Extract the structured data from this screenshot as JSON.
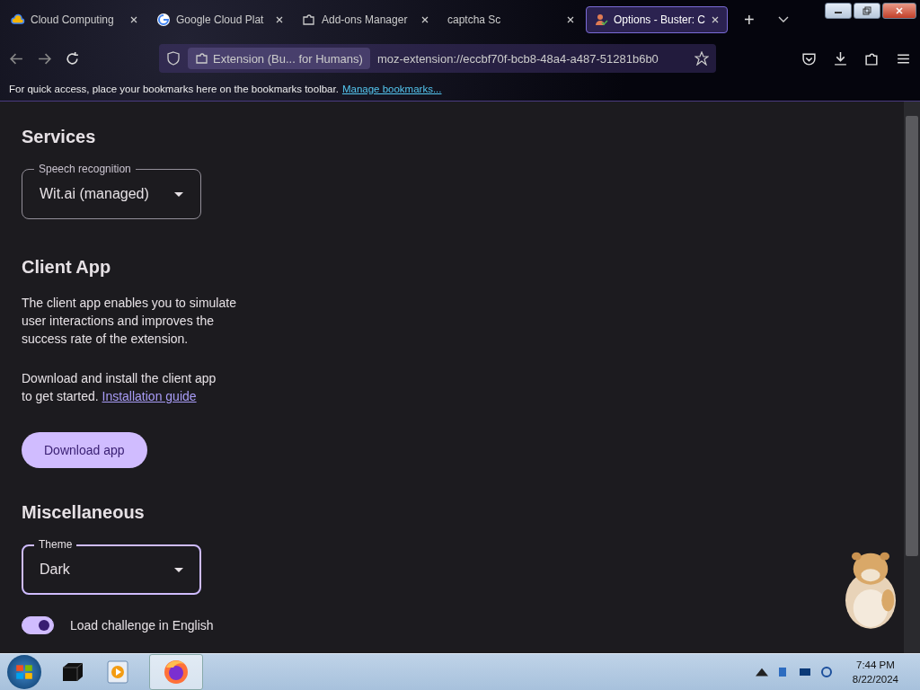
{
  "tabs": [
    {
      "title": "Cloud Computing",
      "selected": false
    },
    {
      "title": "Google Cloud Plat",
      "selected": false
    },
    {
      "title": "Add-ons Manager",
      "selected": false
    },
    {
      "title": "captcha Sc",
      "selected": false
    },
    {
      "title": "Options - Buster: C",
      "selected": true
    }
  ],
  "new_tab": "+",
  "address_bar": {
    "identity": "Extension (Bu... for Humans)",
    "url": "moz-extension://eccbf70f-bcb8-48a4-a487-51281b6b0"
  },
  "bookmarks_bar": {
    "message": "For quick access, place your bookmarks here on the bookmarks toolbar.",
    "link": "Manage bookmarks..."
  },
  "sections": [
    {
      "kind": "select",
      "heading": "Services",
      "label": "Speech recognition",
      "value": "Wit.ai (managed)",
      "focused": false
    },
    {
      "kind": "client",
      "heading": "Client App",
      "description": "The client app enables you to simulate user interactions and improves the success rate of the extension.",
      "install_text": "Download and install the client app to get started.",
      "install_link": "Installation guide",
      "button": "Download app"
    },
    {
      "kind": "select",
      "heading": "Miscellaneous",
      "label": "Theme",
      "value": "Dark",
      "focused": true
    },
    {
      "kind": "toggle",
      "label": "Load challenge in English",
      "on": true
    }
  ],
  "taskbar": {
    "time": "7:44 PM",
    "date": "8/22/2024"
  }
}
